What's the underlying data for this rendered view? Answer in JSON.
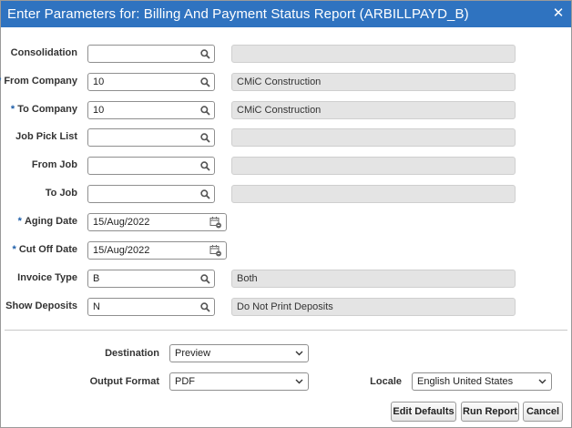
{
  "dialog": {
    "title": "Enter Parameters for: Billing And Payment Status Report (ARBILLPAYD_B)",
    "close_glyph": "✕"
  },
  "fields": {
    "consolidation": {
      "label": "Consolidation",
      "required": false,
      "value": "",
      "description": ""
    },
    "from_company": {
      "label": "From Company",
      "required": true,
      "value": "10",
      "description": "CMiC Construction"
    },
    "to_company": {
      "label": "To Company",
      "required": true,
      "value": "10",
      "description": "CMiC Construction"
    },
    "job_pick_list": {
      "label": "Job Pick List",
      "required": false,
      "value": "",
      "description": ""
    },
    "from_job": {
      "label": "From Job",
      "required": false,
      "value": "",
      "description": ""
    },
    "to_job": {
      "label": "To Job",
      "required": false,
      "value": "",
      "description": ""
    },
    "aging_date": {
      "label": "Aging Date",
      "required": true,
      "value": "15/Aug/2022"
    },
    "cut_off_date": {
      "label": "Cut Off Date",
      "required": true,
      "value": "15/Aug/2022"
    },
    "invoice_type": {
      "label": "Invoice Type",
      "required": false,
      "value": "B",
      "description": "Both"
    },
    "show_deposits": {
      "label": "Show Deposits",
      "required": false,
      "value": "N",
      "description": "Do Not Print Deposits"
    }
  },
  "required_marker": "*",
  "output": {
    "destination": {
      "label": "Destination",
      "value": "Preview"
    },
    "output_format": {
      "label": "Output Format",
      "value": "PDF"
    },
    "locale": {
      "label": "Locale",
      "value": "English United States"
    }
  },
  "buttons": {
    "edit_defaults": "Edit Defaults",
    "run_report": "Run Report",
    "cancel": "Cancel"
  },
  "colors": {
    "title_bar": "#2f73c0",
    "required_marker": "#1c5da8",
    "readonly_field": "#e4e4e4"
  },
  "icons": {
    "lov": "search-icon",
    "date": "calendar-icon",
    "select": "chevron-down-icon",
    "close": "close-icon"
  }
}
